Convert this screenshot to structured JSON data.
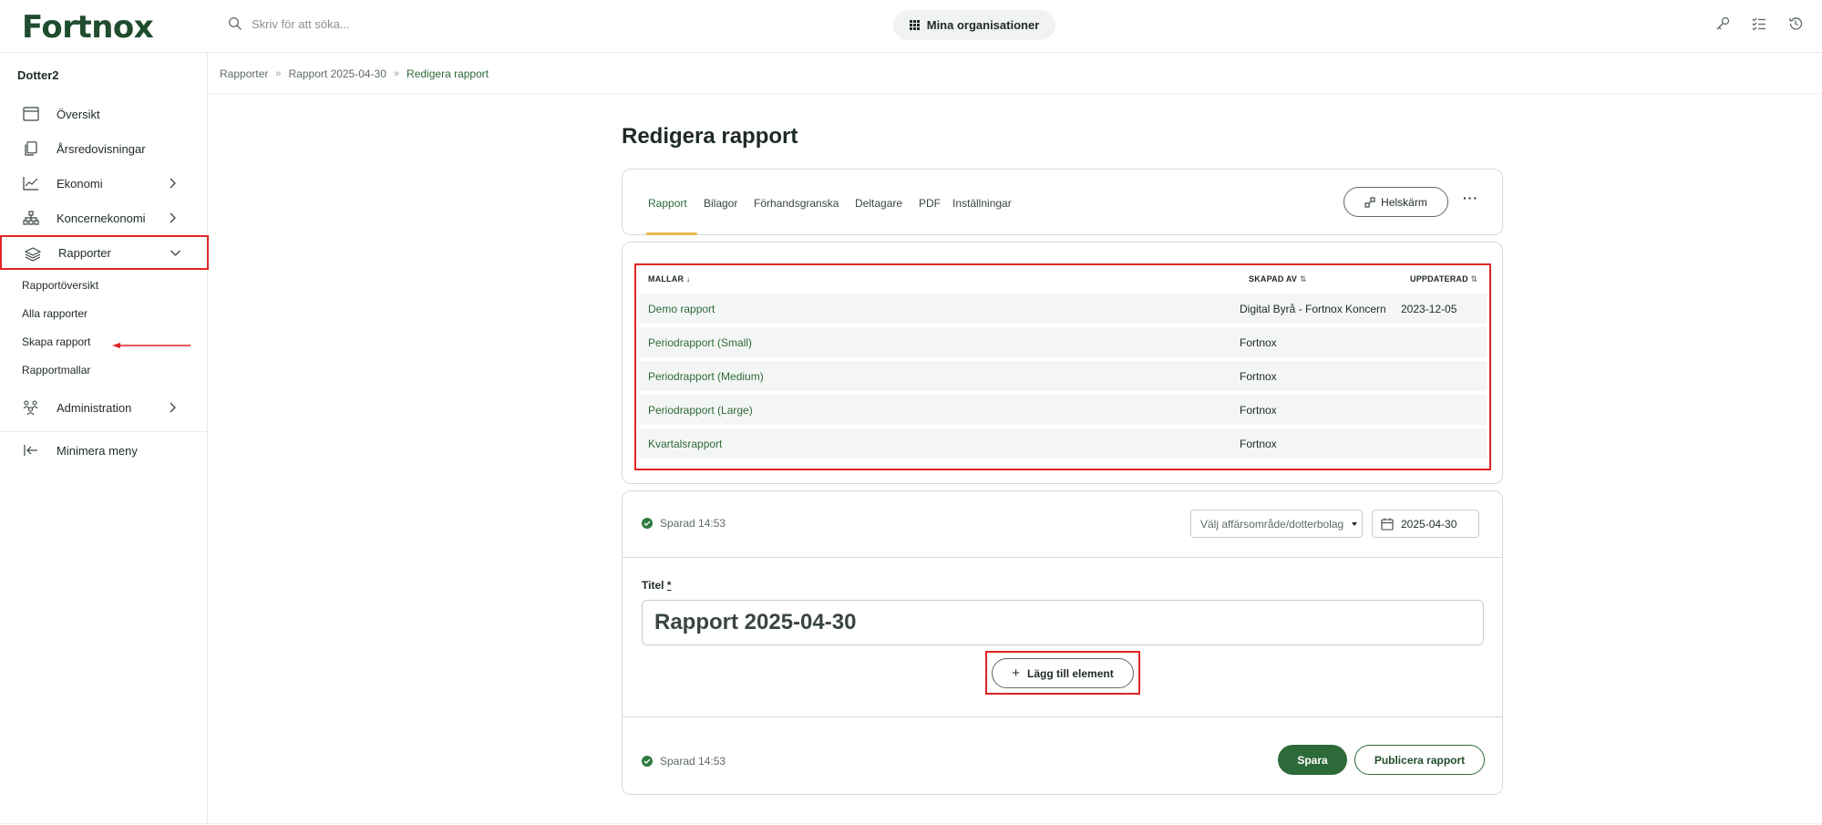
{
  "app": {
    "brand": "Fortnox",
    "search_placeholder": "Skriv för att söka...",
    "org_button": "Mina organisationer",
    "accent": "#2d6a3a",
    "annotation_color": "#e02424"
  },
  "sidebar": {
    "org_name": "Dotter2",
    "items": [
      {
        "label": "Översikt",
        "icon": "calendar-window-icon"
      },
      {
        "label": "Årsredovisningar",
        "icon": "documents-icon"
      },
      {
        "label": "Ekonomi",
        "icon": "line-chart-icon"
      },
      {
        "label": "Koncernekonomi",
        "icon": "org-tree-icon"
      },
      {
        "label": "Rapporter",
        "icon": "layers-icon"
      }
    ],
    "subitems": [
      "Rapportöversikt",
      "Alla rapporter",
      "Skapa rapport",
      "Rapportmallar"
    ],
    "administration": "Administration",
    "minimize": "Minimera meny"
  },
  "breadcrumb": [
    "Rapporter",
    "Rapport 2025-04-30",
    "Redigera rapport"
  ],
  "page": {
    "title": "Redigera rapport",
    "tabs": [
      "Rapport",
      "Bilagor",
      "Förhandsgranska",
      "Deltagare",
      "PDF",
      "Inställningar"
    ],
    "fullscreen": "Helskärm",
    "more": "···"
  },
  "templates": {
    "headers": {
      "name": "MALLAR",
      "created_by": "SKAPAD AV",
      "updated": "UPPDATERAD"
    },
    "rows": [
      {
        "name": "Demo rapport",
        "created_by": "Digital Byrå - Fortnox Koncern",
        "updated": "2023-12-05"
      },
      {
        "name": "Periodrapport (Small)",
        "created_by": "Fortnox",
        "updated": ""
      },
      {
        "name": "Periodrapport (Medium)",
        "created_by": "Fortnox",
        "updated": ""
      },
      {
        "name": "Periodrapport (Large)",
        "created_by": "Fortnox",
        "updated": ""
      },
      {
        "name": "Kvartalsrapport",
        "created_by": "Fortnox",
        "updated": ""
      }
    ]
  },
  "editor": {
    "saved_top": "Sparad 14:53",
    "select_placeholder": "Välj affärsområde/dotterbolag",
    "date": "2025-04-30",
    "title_label": "Titel",
    "required_mark": "*",
    "title_value": "Rapport 2025-04-30",
    "add_element": "Lägg till element",
    "saved_bottom": "Sparad 14:53",
    "save": "Spara",
    "publish": "Publicera rapport"
  }
}
